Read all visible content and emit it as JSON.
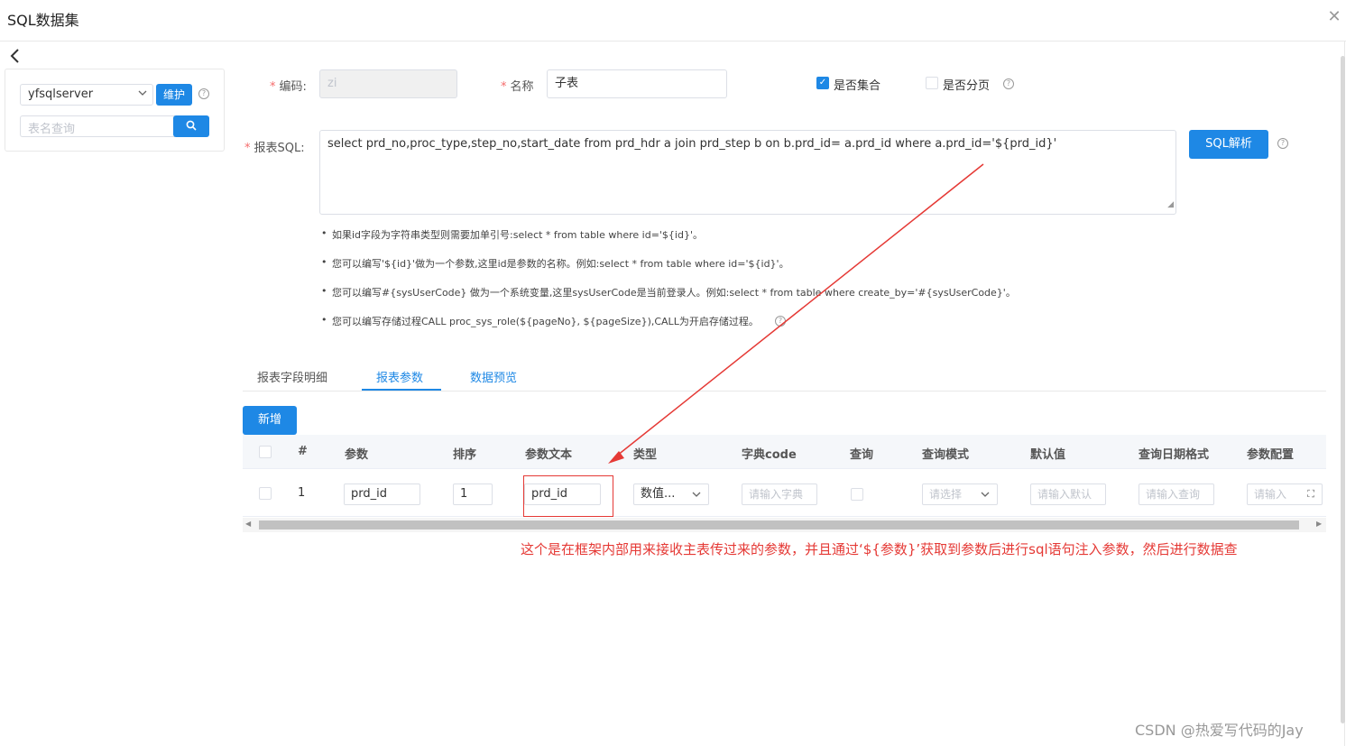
{
  "dialog": {
    "title": "SQL数据集",
    "close_icon": "close-icon",
    "back_icon": "back-arrow-icon"
  },
  "left_panel": {
    "datasource_value": "yfsqlserver",
    "maintain_label": "维护",
    "table_search_placeholder": "表名查询",
    "search_icon": "search-icon"
  },
  "form": {
    "code_label": "编码:",
    "code_value": "zi",
    "name_label": "名称",
    "name_value": "子表",
    "is_collection_label": "是否集合",
    "is_collection_checked": true,
    "is_paging_label": "是否分页",
    "is_paging_checked": false,
    "sql_label": "报表SQL:",
    "sql_value": "select prd_no,proc_type,step_no,start_date from prd_hdr a join prd_step b on b.prd_id= a.prd_id where a.prd_id='${prd_id}'",
    "sql_parse_label": "SQL解析"
  },
  "tips": [
    "如果id字段为字符串类型则需要加单引号:select * from table where id='${id}'。",
    "您可以编写'${id}'做为一个参数,这里id是参数的名称。例如:select * from table where id='${id}'。",
    "您可以编写#{sysUserCode} 做为一个系统变量,这里sysUserCode是当前登录人。例如:select * from table where create_by='#{sysUserCode}'。",
    "您可以编写存储过程CALL proc_sys_role(${pageNo}, ${pageSize}),CALL为开启存储过程。"
  ],
  "tabs": {
    "fields": "报表字段明细",
    "params": "报表参数",
    "preview": "数据预览"
  },
  "add_label": "新增",
  "table": {
    "headers": {
      "index": "#",
      "param": "参数",
      "order": "排序",
      "param_text": "参数文本",
      "type": "类型",
      "dict_code": "字典code",
      "query": "查询",
      "query_mode": "查询模式",
      "default_value": "默认值",
      "date_format": "查询日期格式",
      "param_config": "参数配置"
    },
    "rows": [
      {
        "index": "1",
        "param": "prd_id",
        "order": "1",
        "param_text": "prd_id",
        "type": "数值...",
        "dict_code_ph": "请输入字典",
        "query_mode_ph": "请选择",
        "default_ph": "请输入默认",
        "date_format_ph": "请输入查询",
        "config_ph": "请输入"
      }
    ]
  },
  "annotation": "这个是在框架内部用来接收主表传过来的参数，并且通过‘${参数}’获取到参数后进行sql语句注入参数，然后进行数据查",
  "watermark": "CSDN @热爱写代码的Jay",
  "colors": {
    "primary": "#1e88e5",
    "annotation": "#e53935",
    "required": "#f56c6c"
  }
}
